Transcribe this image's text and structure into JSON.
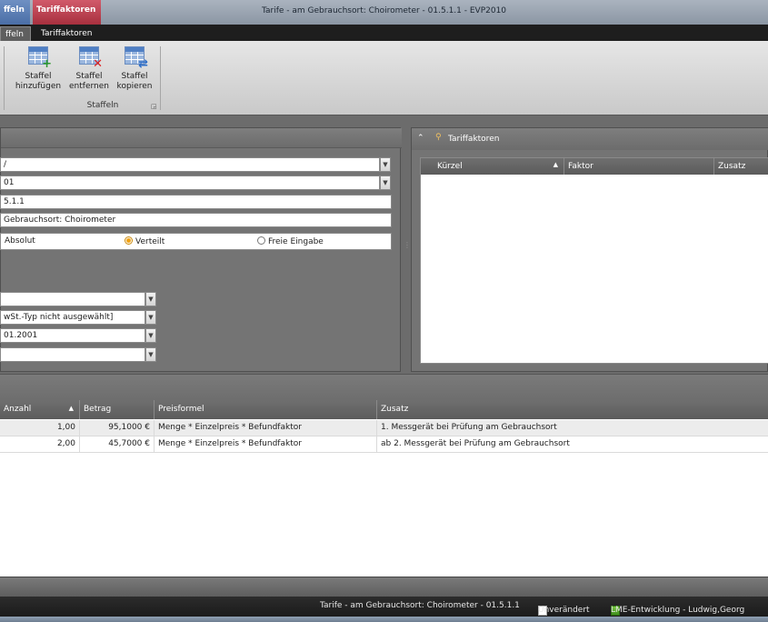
{
  "window": {
    "title": "Tarife - am Gebrauchsort: Choirometer - 01.5.1.1 - EVP2010",
    "context_tab_staffeln": "ffeln",
    "context_tab_tarif": "Tariffaktoren"
  },
  "ribbon": {
    "tabs": [
      "ffeln",
      "Tariffaktoren"
    ],
    "buttons": [
      {
        "line1": "Staffel",
        "line2": "hinzufügen",
        "icon": "grid-add-icon"
      },
      {
        "line1": "Staffel",
        "line2": "entfernen",
        "icon": "grid-remove-icon"
      },
      {
        "line1": "Staffel",
        "line2": "kopieren",
        "icon": "grid-copy-icon"
      }
    ],
    "group_label": "Staffeln"
  },
  "form": {
    "field1": "/",
    "field2": "01",
    "field3": "5.1.1",
    "field4": "Gebrauchsort: Choirometer",
    "radio_absolut": "Absolut",
    "radio_verteilt": "Verteilt",
    "radio_freie": "Freie Eingabe",
    "select_a": "",
    "select_mwst": "wSt.-Typ nicht ausgewählt]",
    "select_date": "01.2001",
    "select_d": ""
  },
  "tariffaktoren": {
    "title": "Tariffaktoren",
    "columns": [
      "Kürzel",
      "Faktor",
      "Zusatz"
    ]
  },
  "staffeln_grid": {
    "columns": [
      "Anzahl",
      "Betrag",
      "Preisformel",
      "Zusatz"
    ],
    "rows": [
      {
        "anzahl": "1,00",
        "betrag": "95,1000 €",
        "preisformel": "Menge * Einzelpreis * Befundfaktor",
        "zusatz": "1. Messgerät bei Prüfung am Gebrauchsort"
      },
      {
        "anzahl": "2,00",
        "betrag": "45,7000 €",
        "preisformel": "Menge * Einzelpreis * Befundfaktor",
        "zusatz": "ab 2. Messgerät bei Prüfung am Gebrauchsort"
      }
    ]
  },
  "statusbar": {
    "document": "Tarife - am Gebrauchsort: Choirometer - 01.5.1.1",
    "state": "Unverändert",
    "connection": "LME-Entwicklung - Ludwig,Georg"
  },
  "colors": {
    "context_staffeln": "#4a6ea6",
    "context_tarif": "#a8303e",
    "radio_selected": "#f0a010"
  }
}
